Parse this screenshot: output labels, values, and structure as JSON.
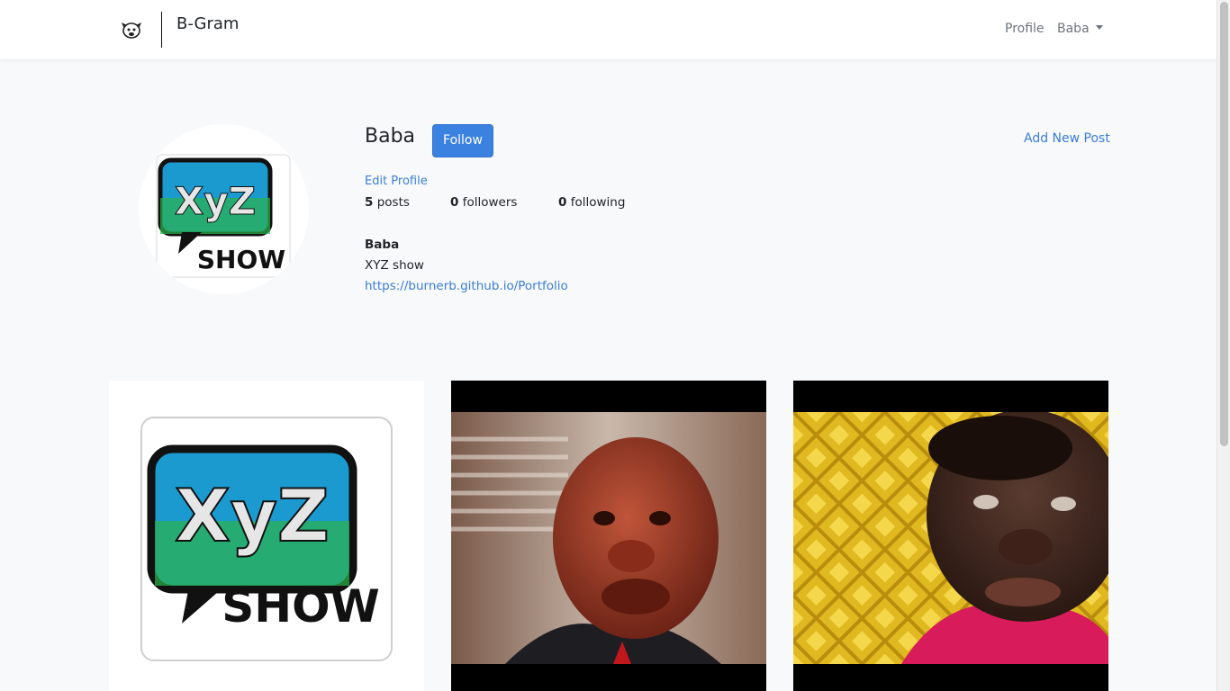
{
  "app": {
    "brand_name": "B-Gram",
    "logo_icon": "pug-dog-logo-icon"
  },
  "nav": {
    "profile_label": "Profile",
    "user_label": "Baba"
  },
  "profile": {
    "username": "Baba",
    "follow_label": "Follow",
    "add_post_label": "Add New Post",
    "edit_profile_label": "Edit Profile",
    "stats": {
      "posts_count": "5",
      "posts_label": "posts",
      "followers_count": "0",
      "followers_label": "followers",
      "following_count": "0",
      "following_label": "following"
    },
    "bio": {
      "title": "Baba",
      "description": "XYZ show",
      "link": "https://burnerb.github.io/Portfolio"
    },
    "avatar_logo": {
      "top_text": "XyZ",
      "bottom_text": "SHOW"
    }
  },
  "posts": [
    {
      "kind": "logo",
      "top_text": "XyZ",
      "bottom_text": "SHOW"
    },
    {
      "kind": "photo",
      "subject": "bald puppet in suit and red tie"
    },
    {
      "kind": "photo",
      "subject": "puppet in red shirt before gold background"
    }
  ],
  "colors": {
    "accent": "#3b82e0",
    "link": "#3b7dd8",
    "page_bg": "#f8f9fa"
  }
}
